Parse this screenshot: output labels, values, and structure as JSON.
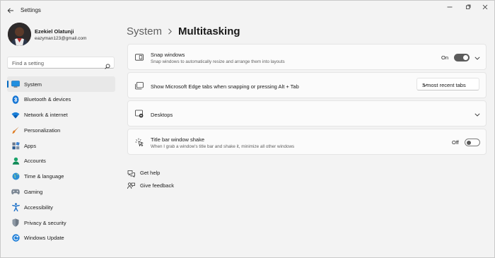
{
  "window": {
    "title": "Settings",
    "controls": [
      "minimize-icon",
      "maximize-icon",
      "close-icon"
    ]
  },
  "profile": {
    "name": "Ezekiel Olatunji",
    "email": "eazyman123@gmail.com"
  },
  "search": {
    "placeholder": "Find a setting",
    "icon": "search-icon"
  },
  "sidebar": {
    "items": [
      {
        "label": "System",
        "icon": "system-icon",
        "active": true
      },
      {
        "label": "Bluetooth & devices",
        "icon": "bluetooth-icon"
      },
      {
        "label": "Network & internet",
        "icon": "wifi-icon"
      },
      {
        "label": "Personalization",
        "icon": "brush-icon"
      },
      {
        "label": "Apps",
        "icon": "apps-icon"
      },
      {
        "label": "Accounts",
        "icon": "accounts-icon"
      },
      {
        "label": "Time & language",
        "icon": "globe-icon"
      },
      {
        "label": "Gaming",
        "icon": "gamepad-icon"
      },
      {
        "label": "Accessibility",
        "icon": "accessibility-icon"
      },
      {
        "label": "Privacy & security",
        "icon": "shield-icon"
      },
      {
        "label": "Windows Update",
        "icon": "update-icon"
      }
    ]
  },
  "breadcrumb": {
    "parent": "System",
    "current": "Multitasking"
  },
  "settings": {
    "snap": {
      "title": "Snap windows",
      "description": "Snap windows to automatically resize and arrange them into layouts",
      "toggle_label": "On",
      "toggle_on": true
    },
    "edge_tabs": {
      "title": "Show Microsoft Edge tabs when snapping or pressing Alt + Tab",
      "selected": "3 most recent tabs"
    },
    "desktops": {
      "title": "Desktops"
    },
    "shake": {
      "title": "Title bar window shake",
      "description": "When I grab a window's title bar and shake it, minimize all other windows",
      "toggle_label": "Off",
      "toggle_on": false
    }
  },
  "links": {
    "help": "Get help",
    "feedback": "Give feedback"
  },
  "colors": {
    "accent": "#0067c0",
    "background": "#f3f3f3",
    "card": "#fbfbfb"
  }
}
